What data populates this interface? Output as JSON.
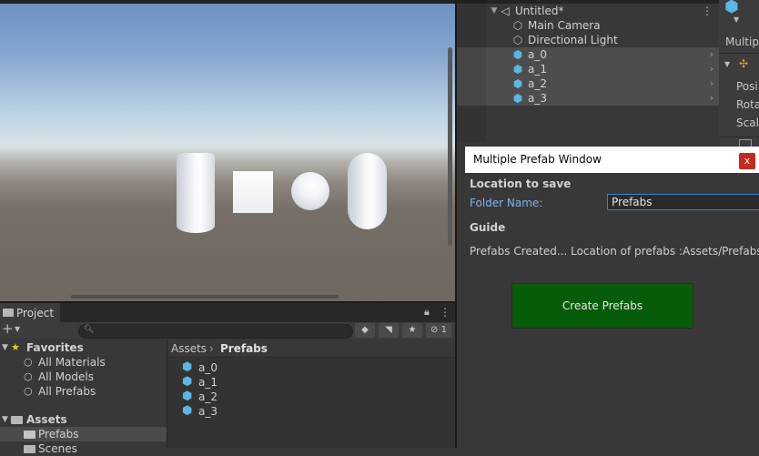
{
  "hierarchy": {
    "scene_name": "Untitled*",
    "items": [
      {
        "label": "Main Camera",
        "icon": "gameobject-icon"
      },
      {
        "label": "Directional Light",
        "icon": "gameobject-icon"
      },
      {
        "label": "a_0",
        "icon": "prefab-icon"
      },
      {
        "label": "a_1",
        "icon": "prefab-icon"
      },
      {
        "label": "a_2",
        "icon": "prefab-icon"
      },
      {
        "label": "a_3",
        "icon": "prefab-icon"
      }
    ]
  },
  "inspector": {
    "header_label": "Multipl",
    "fields": [
      "Posi",
      "Rota",
      "Scal"
    ]
  },
  "prefab_window": {
    "title": "Multiple Prefab Window",
    "close_label": "x",
    "location_heading": "Location to save",
    "folder_label": "Folder Name:",
    "folder_value": "Prefabs",
    "guide_heading": "Guide",
    "guide_text": "Prefabs Created... Location of prefabs :Assets/Prefabs/a",
    "create_button": "Create Prefabs",
    "colors": {
      "button": "#075c0a",
      "close": "#c42b1c",
      "field_label": "#7fb4ef"
    }
  },
  "project": {
    "tab_label": "Project",
    "visibility_count": "1",
    "tree": {
      "favorites_label": "Favorites",
      "favorites": [
        "All Materials",
        "All Models",
        "All Prefabs"
      ],
      "assets_label": "Assets",
      "assets_children": [
        "Prefabs",
        "Scenes"
      ]
    },
    "breadcrumb": {
      "root": "Assets",
      "current": "Prefabs"
    },
    "files": [
      "a_0",
      "a_1",
      "a_2",
      "a_3"
    ]
  }
}
